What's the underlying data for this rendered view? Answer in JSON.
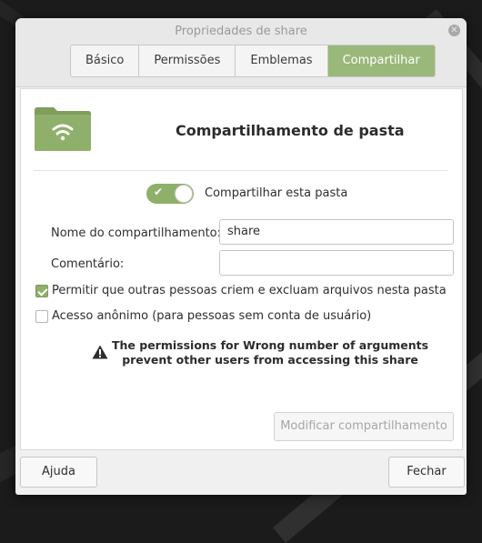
{
  "window": {
    "title": "Propriedades de share"
  },
  "tabs": [
    {
      "label": "Básico",
      "active": false
    },
    {
      "label": "Permissões",
      "active": false
    },
    {
      "label": "Emblemas",
      "active": false
    },
    {
      "label": "Compartilhar",
      "active": true
    }
  ],
  "header": {
    "title": "Compartilhamento de pasta",
    "icon": "shared-folder-icon"
  },
  "share_toggle": {
    "label": "Compartilhar esta pasta",
    "on": true
  },
  "fields": {
    "share_name": {
      "label": "Nome do compartilhamento:",
      "value": "share"
    },
    "comment": {
      "label": "Comentário:",
      "value": ""
    }
  },
  "checkboxes": {
    "allow_others": {
      "label": "Permitir que outras pessoas criem e excluam arquivos nesta pasta",
      "checked": true
    },
    "guest_access": {
      "label": "Acesso anônimo (para pessoas sem conta de usuário)",
      "checked": false
    }
  },
  "warning": {
    "line1": "The permissions for Wrong number of arguments",
    "line2": "prevent other users from accessing this share"
  },
  "buttons": {
    "modify": "Modificar compartilhamento",
    "help": "Ajuda",
    "close": "Fechar"
  },
  "colors": {
    "accent": "#8fb06a",
    "active_tab": "#9ab87a"
  }
}
